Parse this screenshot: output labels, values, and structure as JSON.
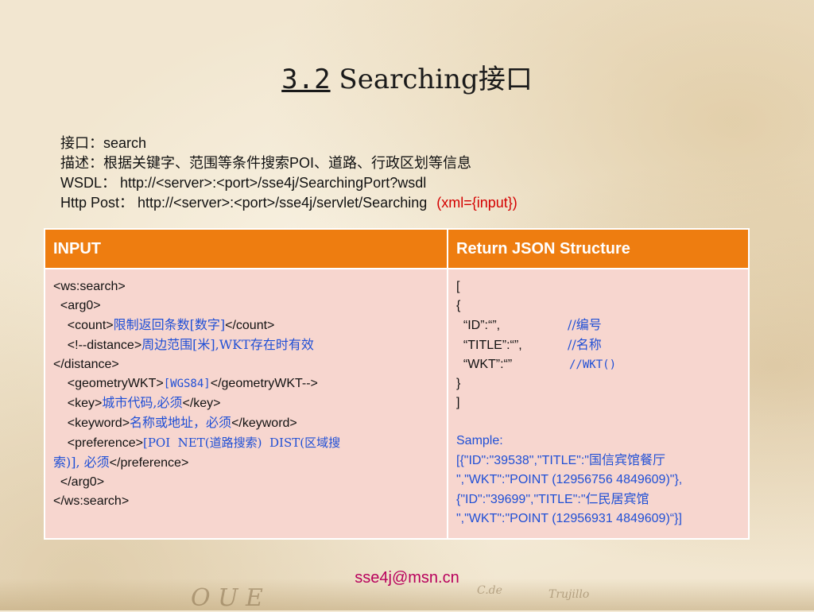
{
  "title": {
    "number": "3.2",
    "text": " Searching接口"
  },
  "info": {
    "interface": "接口：search",
    "description": "描述：根据关键字、范围等条件搜索POI、道路、行政区划等信息",
    "wsdl": "WSDL：  http://<server>:<port>/sse4j/SearchingPort?wsdl",
    "http_post": "Http Post：  http://<server>:<port>/sse4j/servlet/Searching",
    "http_post_param": "(xml={input})"
  },
  "table": {
    "headers": [
      "INPUT",
      "Return JSON Structure"
    ],
    "input": {
      "l1": "<ws:search>",
      "l2": "  <arg0>",
      "l3a": "    <count>",
      "l3b": "限制返回条数[数字]",
      "l3c": "</count>",
      "l4a": "    <!--distance>",
      "l4b": "周边范围[米],WKT存在时有效",
      "l5": "</distance>",
      "l6a": "    <geometryWKT>",
      "l6b": "[WGS84]",
      "l6c": "</geometryWKT-->",
      "l7a": "    <key>",
      "l7b": "城市代码,必须",
      "l7c": "</key>",
      "l8a": "    <keyword>",
      "l8b": "名称或地址，必须",
      "l8c": "</keyword>",
      "l9a": "    <preference>",
      "l9b": "[POI  NET(道路搜索)  DIST(区域搜",
      "l10a": "索)], 必须",
      "l10b": "</preference>",
      "l11": "  </arg0>",
      "l12": "</ws:search>"
    },
    "output": {
      "o1": "[",
      "o2": "{",
      "o3a": "  “ID”:“”,",
      "o3b": "//编号",
      "o4a": "  “TITLE”:“”,",
      "o4b": "//名称",
      "o5a": "  “WKT”:“”",
      "o5b": "//WKT()",
      "o6": "}",
      "o7": "]",
      "sample_label": "Sample:",
      "s1a": "[{\"ID\":\"39538\",\"TITLE\":\"",
      "s1b": "国信宾馆餐厅",
      "s2": "\",\"WKT\":\"POINT (12956756 4849609)\"},",
      "s3a": "{\"ID\":\"39699\",\"TITLE\":\"",
      "s3b": "仁民居宾馆",
      "s4": "\",\"WKT\":\"POINT (12956931 4849609)“}]"
    }
  },
  "footer": {
    "email": "sse4j@msn.cn"
  },
  "colors": {
    "header": "#ee7d10",
    "cell": "#f7d6cf",
    "comment": "#1f4fd6",
    "accent": "#d40000",
    "email": "#b8005c"
  }
}
